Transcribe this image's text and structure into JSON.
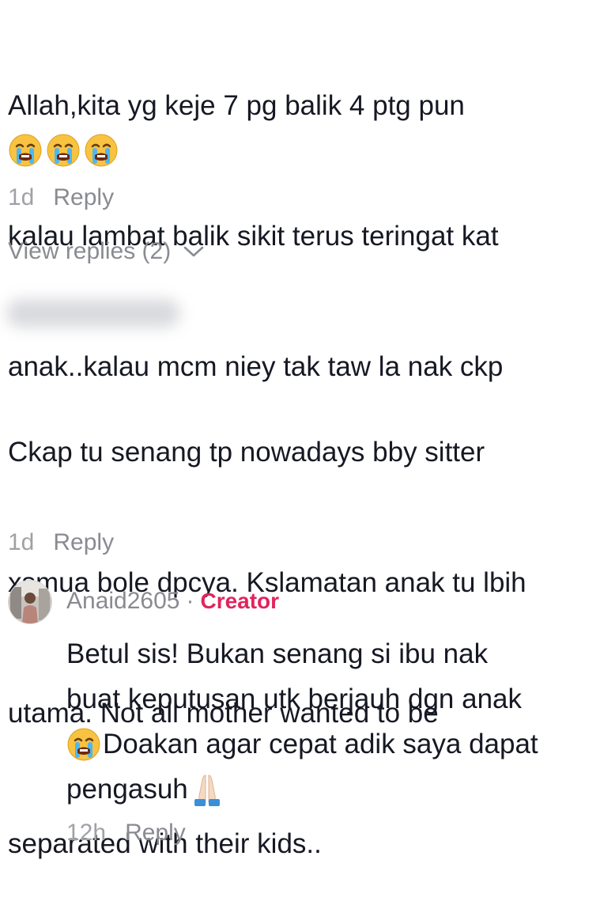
{
  "comments": [
    {
      "text_lines": [
        "Allah,kita yg keje 7 pg balik 4 ptg pun",
        "kalau lambat balik sikit terus teringat kat",
        "anak..kalau mcm niey tak taw la nak ckp"
      ],
      "emojis": [
        "crying-face",
        "crying-face",
        "crying-face"
      ],
      "time": "1d",
      "reply_label": "Reply",
      "view_replies_label": "View replies (2)"
    },
    {
      "text_lines": [
        "Ckap tu senang tp nowadays bby sitter",
        "xsmua bole dpcya. Kslamatan anak tu lbih",
        "utama. Not all mother wanted to be",
        "separated with their kids.."
      ],
      "time": "1d",
      "reply_label": "Reply"
    }
  ],
  "creator_reply": {
    "username": "Anaid2605",
    "separator": "·",
    "badge": "Creator",
    "line1": "Betul sis! Bukan senang si ibu nak",
    "line2": "buat keputusan utk berjauh dgn anak",
    "line3": "Doakan agar cepat adik saya dapat",
    "line4": "pengasuh",
    "time": "12h",
    "reply_label": "Reply"
  },
  "colors": {
    "text": "#161823",
    "meta": "#8a8b91",
    "creator_badge": "#e0245e"
  }
}
